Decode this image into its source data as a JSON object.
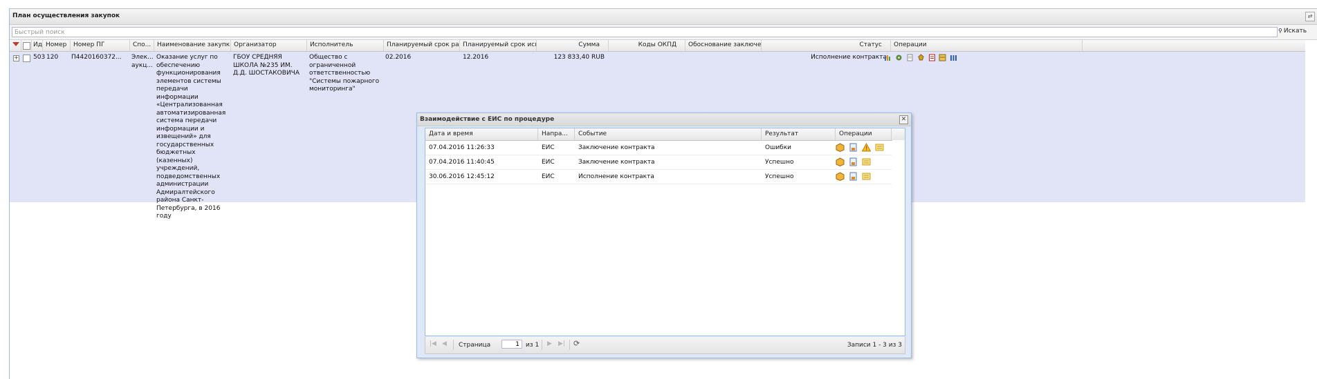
{
  "panel": {
    "title": "План осуществления закупок",
    "search_placeholder": "Быстрый поиск",
    "search_button": "Искать"
  },
  "grid": {
    "columns": [
      "Иде",
      "Номер",
      "Номер ПГ",
      "Спо...",
      "Наименование закупки",
      "Организатор",
      "Исполнитель",
      "Планируемый срок раз...",
      "Планируемый срок исп...",
      "Сумма",
      "Коды ОКПД",
      "Обоснование заключе...",
      "Статус",
      "Операции"
    ],
    "row": {
      "id": "503",
      "number": "120",
      "pg_number": "П4420160372...",
      "method": "Элек... аукц...",
      "name": "Оказание услуг по обеспечению функционирования элементов системы передачи информации «Централизованная автоматизированная система передачи информации и извещений» для государственных бюджетных (казенных) учреждений, подведомственных администрации Адмиралтейского района Санкт-Петербурга, в 2016 году",
      "organizer": "ГБОУ СРЕДНЯЯ ШКОЛА №235 ИМ. Д.Д. ШОСТАКОВИЧА",
      "executor": "Общество с ограниченной ответственностью \"Системы пожарного мониторинга\"",
      "plan_placement": "02.2016",
      "plan_execution": "12.2016",
      "sum": "123 833,40 RUB",
      "okpd": "",
      "justification": "",
      "status": "Исполнение контракта",
      "operations": [
        "chart-icon",
        "gear-icon",
        "document-icon",
        "emblem-icon",
        "report-icon",
        "archive-icon",
        "stats-icon"
      ]
    }
  },
  "modal": {
    "title": "Взаимодействие с ЕИС по процедуре",
    "columns": [
      "Дата и время",
      "Напра...",
      "Событие",
      "Результат",
      "Операции"
    ],
    "rows": [
      {
        "datetime": "07.04.2016 11:26:33",
        "direction": "ЕИС",
        "event": "Заключение контракта",
        "result": "Ошибки",
        "ops": [
          "package-icon",
          "document-icon",
          "warning-icon",
          "note-icon"
        ]
      },
      {
        "datetime": "07.04.2016 11:40:45",
        "direction": "ЕИС",
        "event": "Заключение контракта",
        "result": "Успешно",
        "ops": [
          "package-icon",
          "document-icon",
          "note-icon"
        ]
      },
      {
        "datetime": "30.06.2016 12:45:12",
        "direction": "ЕИС",
        "event": "Исполнение контракта",
        "result": "Успешно",
        "ops": [
          "package-icon",
          "document-icon",
          "note-icon"
        ]
      }
    ],
    "pager": {
      "page_label": "Страница",
      "page_value": "1",
      "of_label": "из 1",
      "records": "Записи 1 - 3 из 3"
    }
  },
  "colors": {
    "row_highlight": "#e1e4f7",
    "border_blue": "#99bbe8",
    "modal_bg": "#dfe8f6"
  }
}
